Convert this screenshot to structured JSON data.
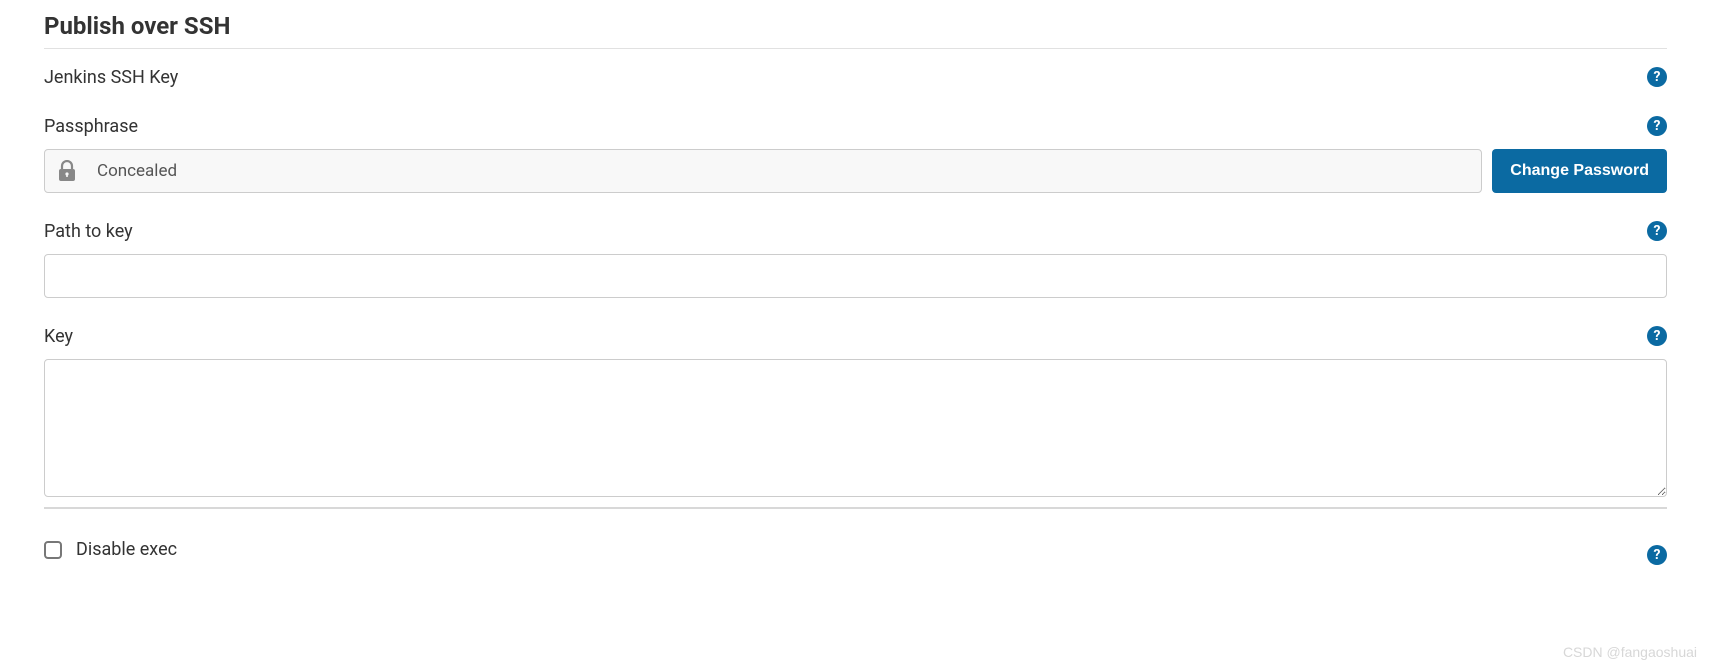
{
  "section": {
    "title": "Publish over SSH"
  },
  "fields": {
    "ssh_key_label": "Jenkins SSH Key",
    "passphrase": {
      "label": "Passphrase",
      "concealed_text": "Concealed",
      "change_button": "Change Password"
    },
    "path_to_key": {
      "label": "Path to key",
      "value": ""
    },
    "key": {
      "label": "Key",
      "value": ""
    },
    "disable_exec": {
      "label": "Disable exec",
      "checked": false
    }
  },
  "watermark": "CSDN @fangaoshuai"
}
